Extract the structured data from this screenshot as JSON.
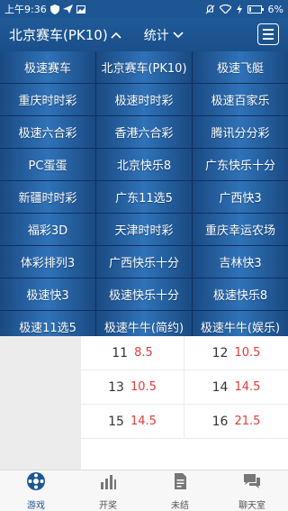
{
  "status_bar": {
    "time": "上午9:36",
    "battery": "6%"
  },
  "header": {
    "title": "北京赛车(PK10)",
    "stats_label": "统计"
  },
  "lottery_grid": [
    "极速赛车",
    "北京赛车(PK10)",
    "极速飞艇",
    "重庆时时彩",
    "极速时时彩",
    "极速百家乐",
    "极速六合彩",
    "香港六合彩",
    "腾讯分分彩",
    "PC蛋蛋",
    "北京快乐8",
    "广东快乐十分",
    "新疆时时彩",
    "广东11选5",
    "广西快3",
    "福彩3D",
    "天津时时彩",
    "重庆幸运农场",
    "体彩排列3",
    "广西快乐十分",
    "吉林快3",
    "极速快3",
    "极速快乐十分",
    "极速快乐8",
    "极速11选5",
    "极速牛牛(简约)",
    "极速牛牛(娱乐)"
  ],
  "odds_rows": [
    [
      {
        "num": "11",
        "odds": "8.5"
      },
      {
        "num": "12",
        "odds": "10.5"
      }
    ],
    [
      {
        "num": "13",
        "odds": "10.5"
      },
      {
        "num": "14",
        "odds": "14.5"
      }
    ],
    [
      {
        "num": "15",
        "odds": "14.5"
      },
      {
        "num": "16",
        "odds": "21.5"
      }
    ]
  ],
  "tabbar": [
    {
      "label": "游戏",
      "icon": "game-icon",
      "active": true
    },
    {
      "label": "开奖",
      "icon": "bar-chart-icon",
      "active": false
    },
    {
      "label": "未结",
      "icon": "document-icon",
      "active": false
    },
    {
      "label": "聊天室",
      "icon": "chat-icon",
      "active": false
    }
  ],
  "colors": {
    "brand_blue": "#1e5694",
    "odds_red": "#e23b3b"
  }
}
